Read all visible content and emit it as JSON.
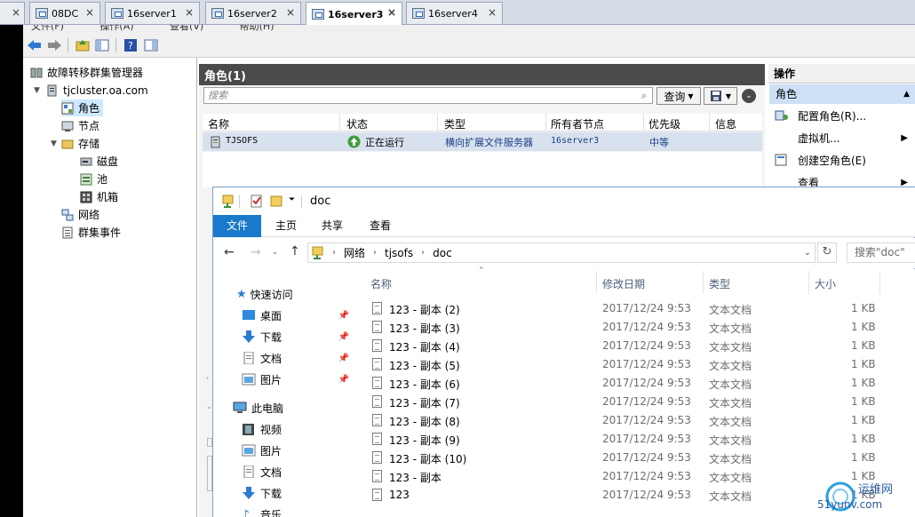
{
  "vm_tabs": [
    "08DC",
    "16server1",
    "16server2",
    "16server3",
    "16server4"
  ],
  "mmc": {
    "menu": [
      "文件(F)",
      "操作(A)",
      "查看(V)",
      "帮助(H)"
    ],
    "tree": {
      "root": "故障转移群集管理器",
      "cluster": "tjcluster.oa.com",
      "roles": "角色",
      "nodes": "节点",
      "storage": "存储",
      "disks": "磁盘",
      "pools": "池",
      "enclosures": "机箱",
      "networks": "网络",
      "cluster_events": "群集事件"
    },
    "center": {
      "title": "角色(1)",
      "search_placeholder": "搜索",
      "query_button": "查询",
      "columns": [
        "名称",
        "状态",
        "类型",
        "所有者节点",
        "优先级",
        "信息"
      ],
      "rows": [
        {
          "name": "TJSOFS",
          "status": "正在运行",
          "type": "横向扩展文件服务器",
          "owner": "16server3",
          "priority": "中等",
          "info": ""
        }
      ]
    },
    "actions": {
      "title": "操作",
      "section": "角色",
      "items": [
        "配置角色(R)...",
        "虚拟机...",
        "创建空角色(E)",
        "查看"
      ]
    }
  },
  "explorer": {
    "title": "doc",
    "ribbon_tabs": [
      "文件",
      "主页",
      "共享",
      "查看"
    ],
    "breadcrumb": [
      "网络",
      "tjsofs",
      "doc"
    ],
    "search_placeholder": "搜索\"doc\"",
    "nav": {
      "quick_access": "快速访问",
      "items_pinned": [
        "桌面",
        "下载",
        "文档",
        "图片"
      ],
      "this_pc": "此电脑",
      "pc_items": [
        "视频",
        "图片",
        "文档",
        "下载",
        "音乐"
      ]
    },
    "columns": [
      "名称",
      "修改日期",
      "类型",
      "大小"
    ],
    "files": [
      {
        "name": "123 - 副本 (2)",
        "date": "2017/12/24 9:53",
        "type": "文本文档",
        "size": "1 KB"
      },
      {
        "name": "123 - 副本 (3)",
        "date": "2017/12/24 9:53",
        "type": "文本文档",
        "size": "1 KB"
      },
      {
        "name": "123 - 副本 (4)",
        "date": "2017/12/24 9:53",
        "type": "文本文档",
        "size": "1 KB"
      },
      {
        "name": "123 - 副本 (5)",
        "date": "2017/12/24 9:53",
        "type": "文本文档",
        "size": "1 KB"
      },
      {
        "name": "123 - 副本 (6)",
        "date": "2017/12/24 9:53",
        "type": "文本文档",
        "size": "1 KB"
      },
      {
        "name": "123 - 副本 (7)",
        "date": "2017/12/24 9:53",
        "type": "文本文档",
        "size": "1 KB"
      },
      {
        "name": "123 - 副本 (8)",
        "date": "2017/12/24 9:53",
        "type": "文本文档",
        "size": "1 KB"
      },
      {
        "name": "123 - 副本 (9)",
        "date": "2017/12/24 9:53",
        "type": "文本文档",
        "size": "1 KB"
      },
      {
        "name": "123 - 副本 (10)",
        "date": "2017/12/24 9:53",
        "type": "文本文档",
        "size": "1 KB"
      },
      {
        "name": "123 - 副本",
        "date": "2017/12/24 9:53",
        "type": "文本文档",
        "size": "1 KB"
      },
      {
        "name": "123",
        "date": "2017/12/24 9:53",
        "type": "文本文档",
        "size": "1 KB"
      }
    ]
  },
  "watermark": {
    "text1": "运维网",
    "text2": "51yunv.com"
  },
  "colors": {
    "accent": "#1979ca",
    "selection": "#cde8ff",
    "role_row": "#d8e2ee",
    "header_dark": "#4a4a4a"
  }
}
